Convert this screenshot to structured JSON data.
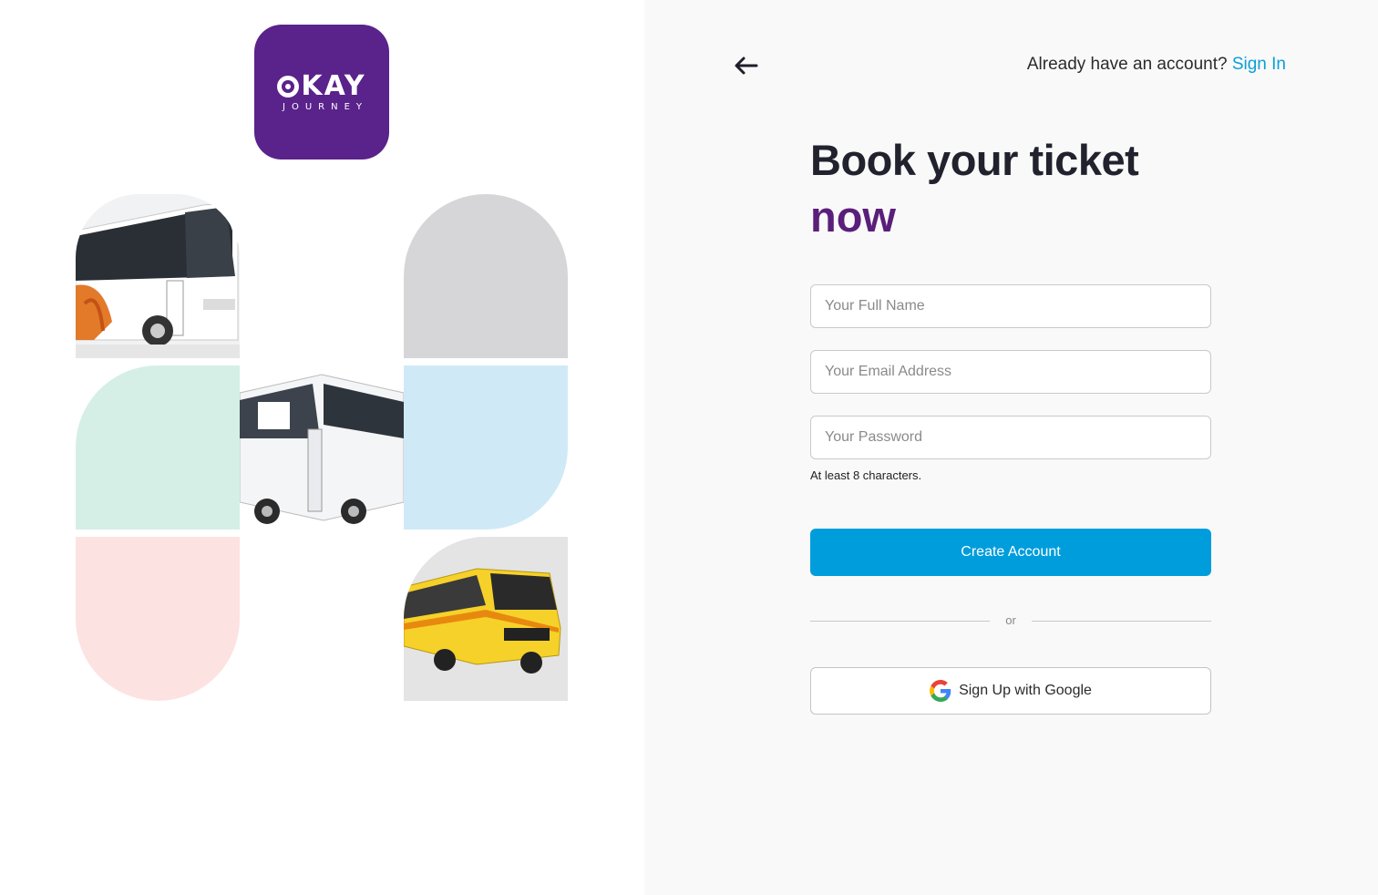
{
  "brand": {
    "logo_word": "KAY",
    "logo_sub": "JOURNEY",
    "logo_color": "#5a228b"
  },
  "header": {
    "back_icon": "arrow-left-icon",
    "have_account_text": "Already have an account?",
    "sign_in_label": "Sign In"
  },
  "hero": {
    "title_line1": "Book your ticket",
    "title_line2": "now"
  },
  "form": {
    "full_name": {
      "placeholder": "Your Full Name",
      "value": ""
    },
    "email": {
      "placeholder": "Your Email Address",
      "value": ""
    },
    "password": {
      "placeholder": "Your Password",
      "value": ""
    },
    "password_hint": "At least 8 characters.",
    "create_label": "Create Account",
    "divider_text": "or",
    "google_label": "Sign Up with Google",
    "google_icon": "google-icon"
  },
  "colors": {
    "accent": "#009ddc",
    "title": "#22222e",
    "title_accent": "#5a1f7a"
  }
}
